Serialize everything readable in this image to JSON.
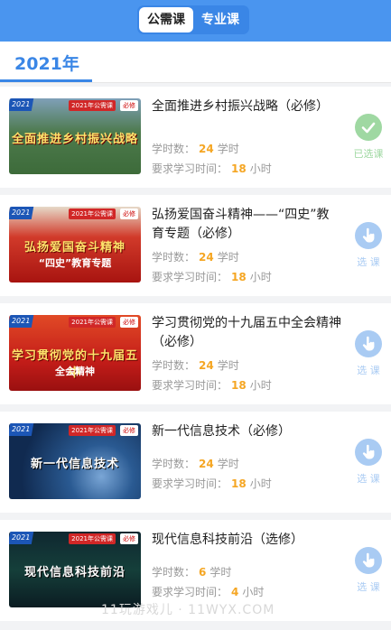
{
  "tabs": [
    {
      "label": "公需课",
      "active": true
    },
    {
      "label": "专业课",
      "active": false
    }
  ],
  "year": "2021年",
  "courses": [
    {
      "title": "全面推进乡村振兴战略（必修）",
      "hours_label": "学时数：",
      "hours": "24",
      "hours_unit": "学时",
      "study_label": "要求学习时间：",
      "study": "18",
      "study_unit": "小时",
      "status": "已选课",
      "status_icon": "check-icon",
      "thumb": {
        "year": "2021",
        "category": "2021年公需课",
        "tag": "必修",
        "banner": "全面推进乡村振兴战略",
        "banner2": "",
        "bg": "#3d6b3a"
      }
    },
    {
      "title": "弘扬爱国奋斗精神——“四史”教育专题（必修）",
      "hours_label": "学时数：",
      "hours": "24",
      "hours_unit": "学时",
      "study_label": "要求学习时间：",
      "study": "18",
      "study_unit": "小时",
      "status": "选 课",
      "status_icon": "hand-pointer-icon",
      "thumb": {
        "year": "2021",
        "category": "2021年公需课",
        "tag": "必修",
        "banner": "弘扬爱国奋斗精神",
        "banner2": "“四史”教育专题",
        "bg": "#c9201c"
      }
    },
    {
      "title": "学习贯彻党的十九届五中全会精神（必修）",
      "hours_label": "学时数：",
      "hours": "24",
      "hours_unit": "学时",
      "study_label": "要求学习时间：",
      "study": "18",
      "study_unit": "小时",
      "status": "选 课",
      "status_icon": "hand-pointer-icon",
      "thumb": {
        "year": "2021",
        "category": "2021年公需课",
        "tag": "必修",
        "banner": "学习贯彻党的十九届五中",
        "banner2": "全会精神",
        "bg": "#c41d19"
      }
    },
    {
      "title": "新一代信息技术（必修）",
      "hours_label": "学时数：",
      "hours": "24",
      "hours_unit": "学时",
      "study_label": "要求学习时间：",
      "study": "18",
      "study_unit": "小时",
      "status": "选 课",
      "status_icon": "hand-pointer-icon",
      "thumb": {
        "year": "2021",
        "category": "2021年公需课",
        "tag": "必修",
        "banner": "新一代信息技术",
        "banner2": "",
        "bg": "#1b3a68"
      }
    },
    {
      "title": "现代信息科技前沿（选修）",
      "hours_label": "学时数：",
      "hours": "6",
      "hours_unit": "学时",
      "study_label": "要求学习时间：",
      "study": "4",
      "study_unit": "小时",
      "status": "选 课",
      "status_icon": "hand-pointer-icon",
      "thumb": {
        "year": "2021",
        "category": "2021年公需课",
        "tag": "必修",
        "banner": "现代信息科技前沿",
        "banner2": "",
        "bg": "#12303a"
      }
    }
  ],
  "watermark": "11玩游戏儿 · 11WYX.COM"
}
